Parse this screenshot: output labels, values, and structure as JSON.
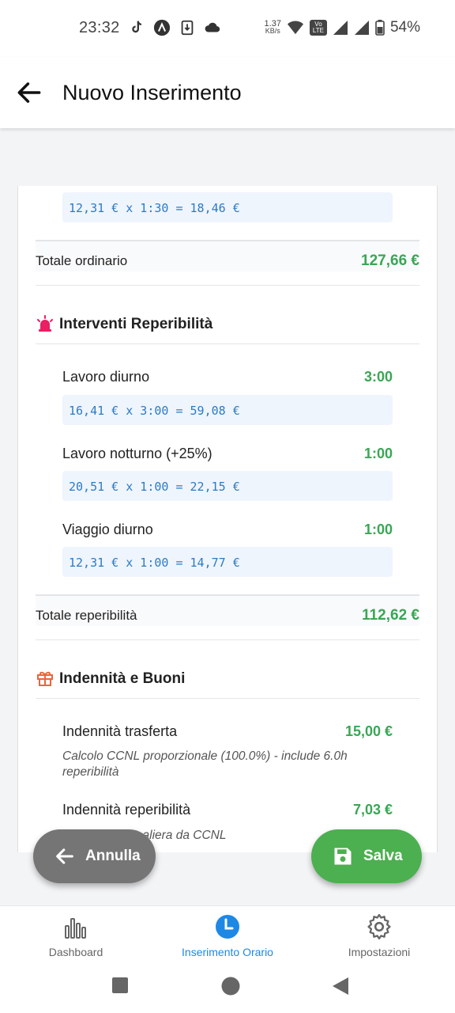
{
  "status_bar": {
    "time": "23:32",
    "speed_value": "1.37",
    "speed_unit": "KB/s",
    "network_badge": "Vo LTE",
    "battery": "54%"
  },
  "header": {
    "title": "Nuovo Inserimento",
    "back_icon": "arrow-left-icon"
  },
  "ordinario": {
    "last_calc": "12,31 € x 1:30 = 18,46 €",
    "total_label": "Totale ordinario",
    "total_value": "127,66 €"
  },
  "reperibilita": {
    "title": "Interventi Reperibilità",
    "icon": "siren-icon",
    "rows": [
      {
        "label": "Lavoro diurno",
        "hours": "3:00",
        "calc": "16,41 € x 3:00 = 59,08 €"
      },
      {
        "label": "Lavoro notturno (+25%)",
        "hours": "1:00",
        "calc": "20,51 € x 1:00 = 22,15 €"
      },
      {
        "label": "Viaggio diurno",
        "hours": "1:00",
        "calc": "12,31 € x 1:00 = 14,77 €"
      }
    ],
    "total_label": "Totale reperibilità",
    "total_value": "112,62 €"
  },
  "indennita": {
    "title": "Indennità e Buoni",
    "icon": "gift-icon",
    "rows": [
      {
        "label": "Indennità trasferta",
        "value": "15,00 €",
        "note": "Calcolo CCNL proporzionale (100.0%) - include 6.0h reperibilità"
      },
      {
        "label": "Indennità reperibilità",
        "value": "7,03 €",
        "note": "…aliera da CCNL"
      }
    ]
  },
  "actions": {
    "cancel_label": "Annulla",
    "save_label": "Salva"
  },
  "bottom_nav": {
    "items": [
      {
        "label": "Dashboard",
        "icon": "bar-chart-icon",
        "active": false
      },
      {
        "label": "Inserimento Orario",
        "icon": "clock-icon",
        "active": true
      },
      {
        "label": "Impostazioni",
        "icon": "gear-icon",
        "active": false
      }
    ]
  },
  "colors": {
    "accent_green": "#3aa655",
    "save_green": "#4caf50",
    "calc_blue": "#2b7bc4",
    "nav_active": "#1e88e5",
    "cancel_gray": "#757575"
  }
}
